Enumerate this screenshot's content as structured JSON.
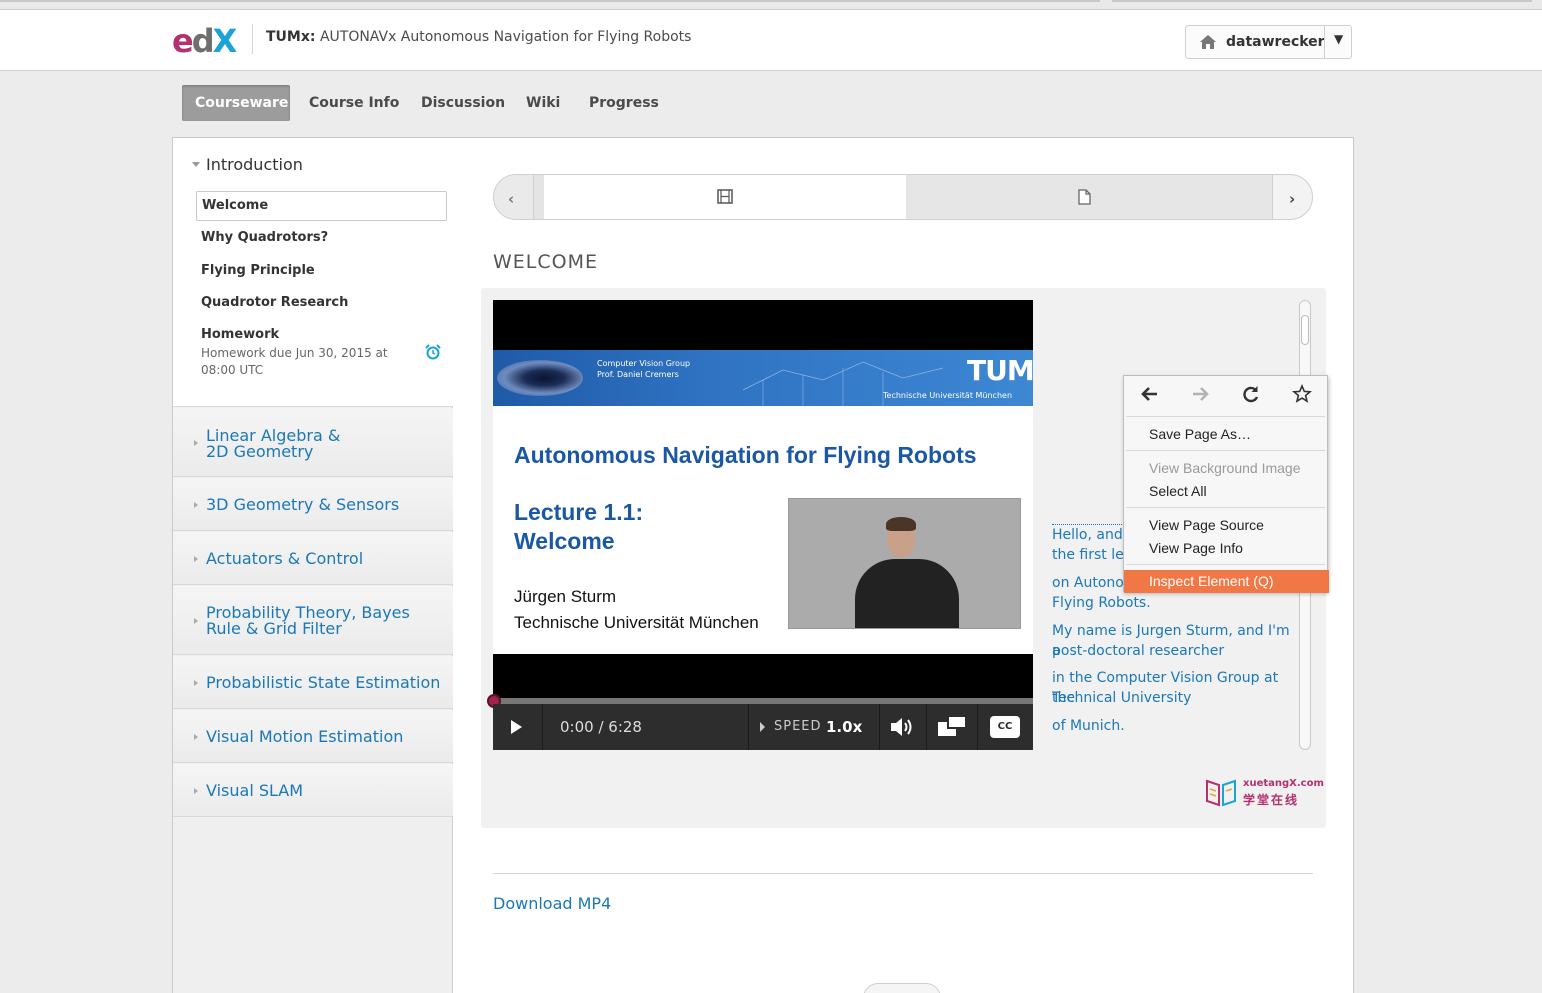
{
  "header": {
    "logo_text": "edX",
    "course_org": "TUMx:",
    "course_name": "AUTONAVx Autonomous Navigation for Flying Robots",
    "username": "datawrecker",
    "dropdown_caret": "▼"
  },
  "tabs": [
    {
      "label": "Courseware",
      "active": true
    },
    {
      "label": "Course Info"
    },
    {
      "label": "Discussion"
    },
    {
      "label": "Wiki"
    },
    {
      "label": "Progress"
    }
  ],
  "sidebar": {
    "open_chapter": "Introduction",
    "subsections": [
      {
        "label": "Welcome",
        "active": true
      },
      {
        "label": "Why Quadrotors?"
      },
      {
        "label": "Flying Principle"
      },
      {
        "label": "Quadrotor Research"
      },
      {
        "label": "Homework"
      }
    ],
    "homework_due": "Homework due Jun 30, 2015 at 08:00 UTC",
    "chapters": [
      {
        "line1": "Linear Algebra &",
        "line2": "2D Geometry"
      },
      {
        "line1": "3D Geometry & Sensors"
      },
      {
        "line1": "Actuators & Control"
      },
      {
        "line1": "Probability Theory, Bayes",
        "line2": "Rule & Grid Filter"
      },
      {
        "line1": "Probabilistic State Estimation"
      },
      {
        "line1": "Visual Motion Estimation"
      },
      {
        "line1": "Visual SLAM"
      }
    ]
  },
  "unit": {
    "title": "WELCOME",
    "download_label": "Download MP4"
  },
  "video": {
    "slide": {
      "group_line1": "Computer Vision Group",
      "group_line2": "Prof. Daniel Cremers",
      "logo": "TUM",
      "university_small": "Technische Universität München",
      "title": "Autonomous Navigation for Flying Robots",
      "lecture_line1": "Lecture 1.1:",
      "lecture_line2": "Welcome",
      "author": "Jürgen Sturm",
      "university": "Technische Universität München"
    },
    "time": "0:00 / 6:28",
    "speed_label": "SPEED",
    "speed_value": "1.0x",
    "cc_label": "CC",
    "progress": 0.0
  },
  "transcript": [
    "Hello, and",
    "the first lec",
    "on Autono",
    "Flying Robots.",
    "My name is Jurgen Sturm, and I'm a",
    "post-doctoral researcher",
    "in the Computer Vision Group at the",
    "Technical University",
    "of Munich."
  ],
  "watermark": {
    "line1": "xuetangX.com",
    "line2": "学堂在线"
  },
  "context_menu": {
    "items": [
      {
        "label": "Save Page As…"
      },
      {
        "label": "View Background Image",
        "disabled": true
      },
      {
        "label": "Select All"
      },
      {
        "label": "View Page Source"
      },
      {
        "label": "View Page Info"
      },
      {
        "label": "Inspect Element (Q)",
        "highlighted": true
      }
    ]
  },
  "colors": {
    "link": "#1b78b7",
    "menu_highlight": "#f07746",
    "edx_magenta": "#b5306f",
    "edx_blue": "#1aa3d7"
  }
}
